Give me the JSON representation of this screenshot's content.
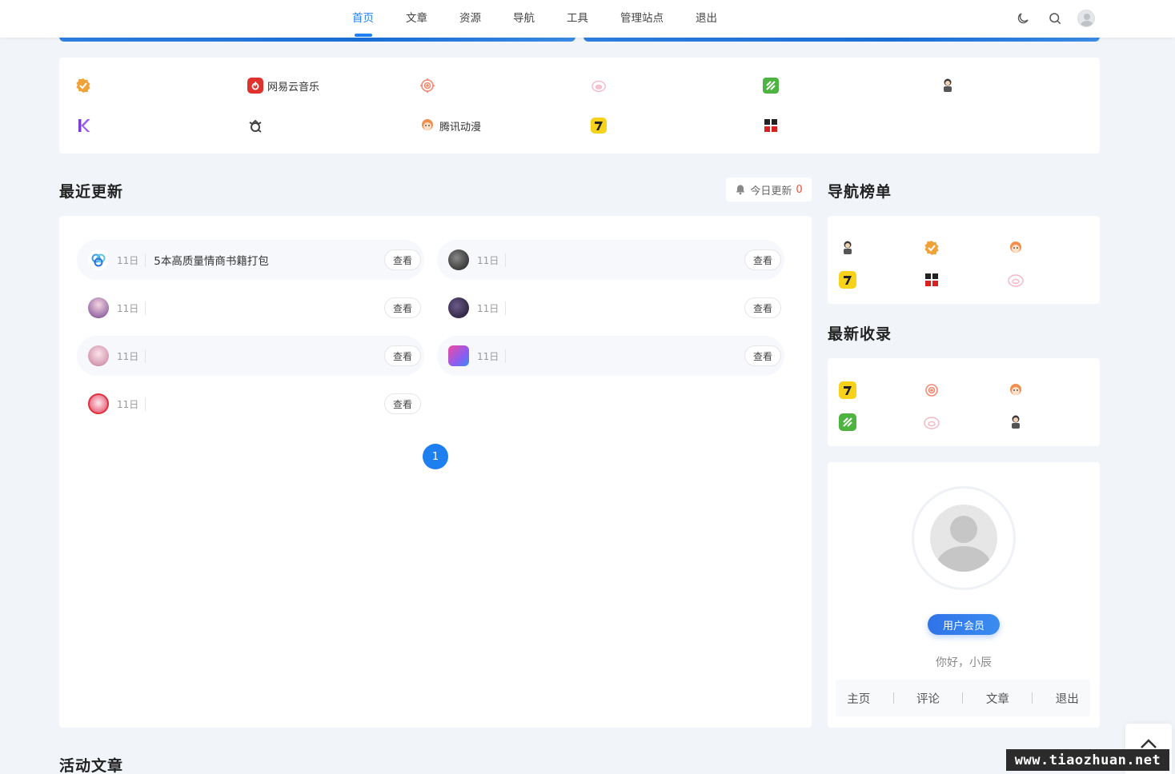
{
  "nav": {
    "items": [
      {
        "label": "首页",
        "active": true
      },
      {
        "label": "文章"
      },
      {
        "label": "资源"
      },
      {
        "label": "导航"
      },
      {
        "label": "工具"
      },
      {
        "label": "管理站点"
      },
      {
        "label": "退出"
      }
    ],
    "icons": [
      "moon-icon",
      "search-icon",
      "user-avatar"
    ]
  },
  "sites": [
    {
      "label": "",
      "icon": "verified-badge-icon",
      "color": "#f0a23a"
    },
    {
      "label": "网易云音乐",
      "icon": "netease-music-icon",
      "color": "#e0322d"
    },
    {
      "label": "",
      "icon": "target-icon",
      "color": "#f28a73"
    },
    {
      "label": "",
      "icon": "pig-icon",
      "color": "#f4b8c6"
    },
    {
      "label": "",
      "icon": "leaf-icon",
      "color": "#4db341"
    },
    {
      "label": "",
      "icon": "cartoon-character-icon",
      "color": "#555555"
    },
    {
      "label": "",
      "icon": "k-logo-icon",
      "color": "#7a3fd6"
    },
    {
      "label": "",
      "icon": "q-logo-icon",
      "color": "#444444"
    },
    {
      "label": "腾讯动漫",
      "icon": "tencent-comic-icon",
      "color": "#f08f4e"
    },
    {
      "label": "",
      "icon": "seven-logo-icon",
      "color": "#f6d21a"
    },
    {
      "label": "",
      "icon": "xiaodao-logo-icon",
      "color": "#d8201e"
    }
  ],
  "recent": {
    "title": "最近更新",
    "today_label": "今日更新",
    "today_count": "0",
    "view_label": "查看",
    "rows": [
      {
        "date": "11日",
        "title": "5本高质量情商书籍打包",
        "avatar": "baidu-pan-icon"
      },
      {
        "date": "11日",
        "title": "",
        "avatar": "dark-avatar"
      },
      {
        "date": "11日",
        "title": "",
        "avatar": "anime-avatar"
      },
      {
        "date": "11日",
        "title": "",
        "avatar": "dark-avatar"
      },
      {
        "date": "11日",
        "title": "",
        "avatar": "anime-avatar"
      },
      {
        "date": "11日",
        "title": "",
        "avatar": "app-avatar"
      },
      {
        "date": "11日",
        "title": "",
        "avatar": "anime-avatar"
      }
    ],
    "pagination": [
      "1"
    ]
  },
  "nav_rank": {
    "title": "导航榜单",
    "logos": [
      "cartoon-character-icon",
      "verified-badge-icon",
      "tencent-comic-icon",
      "seven-logo-icon",
      "xiaodao-logo-icon",
      "pig-icon"
    ]
  },
  "newest": {
    "title": "最新收录",
    "logos": [
      "seven-logo-icon",
      "target-icon",
      "tencent-comic-icon",
      "leaf-icon",
      "pig-icon",
      "cartoon-character-icon"
    ]
  },
  "user_card": {
    "member_label": "用户会员",
    "greeting": "你好，小辰",
    "links": [
      "主页",
      "评论",
      "文章",
      "退出"
    ]
  },
  "active_articles": {
    "title": "活动文章"
  },
  "watermark": "www.tiaozhuan.net",
  "colors": {
    "accent": "#1e7ff0",
    "count": "#f0503c"
  }
}
